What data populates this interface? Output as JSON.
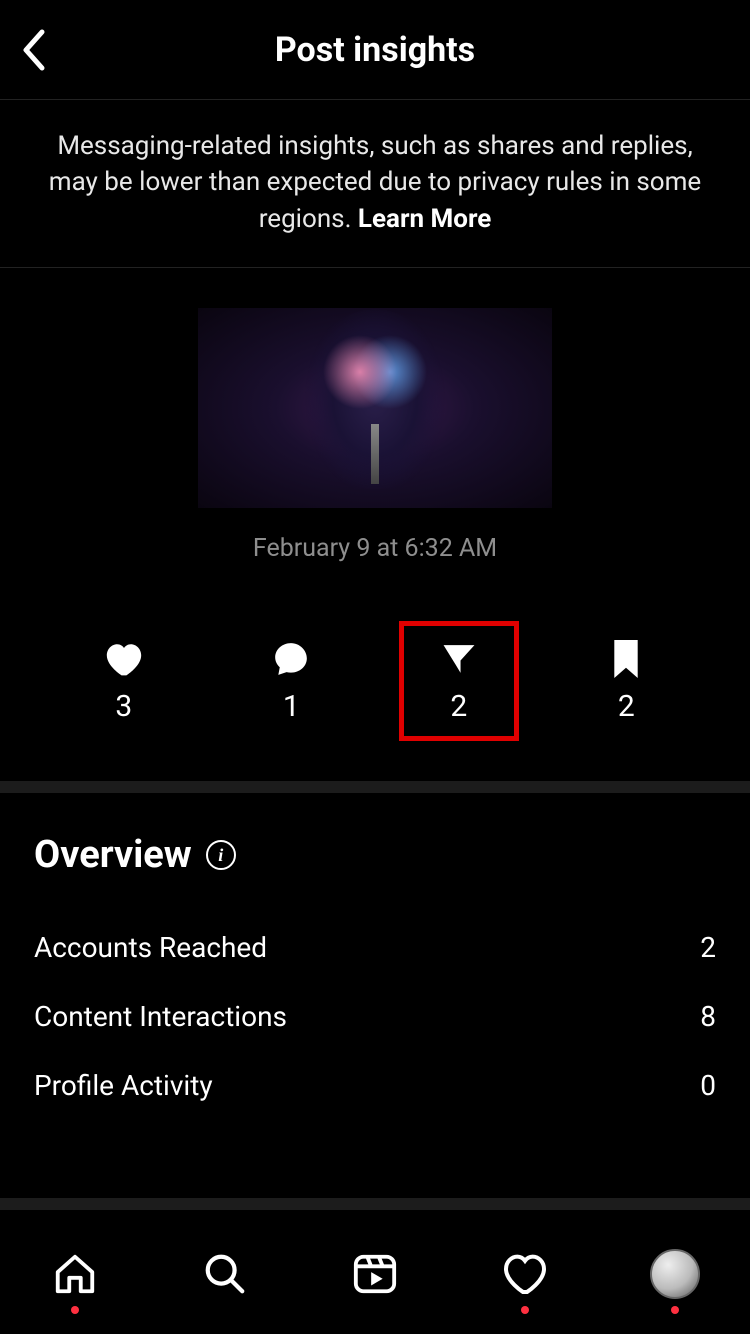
{
  "header": {
    "title": "Post insights"
  },
  "notice": {
    "text": "Messaging-related insights, such as shares and replies, may be lower than expected due to privacy rules in some regions. ",
    "learn_more": "Learn More"
  },
  "post": {
    "date": "February 9 at 6:32 AM"
  },
  "stats": {
    "likes": "3",
    "comments": "1",
    "shares": "2",
    "saves": "2"
  },
  "overview": {
    "title": "Overview",
    "metrics": [
      {
        "label": "Accounts Reached",
        "value": "2"
      },
      {
        "label": "Content Interactions",
        "value": "8"
      },
      {
        "label": "Profile Activity",
        "value": "0"
      }
    ]
  }
}
